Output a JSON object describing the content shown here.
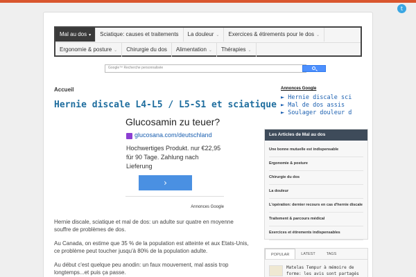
{
  "colors": {
    "accent": "#d9562e",
    "nav_active": "#3a3a3a",
    "link": "#1e6d9e",
    "twitter": "#3aa7e3"
  },
  "header": {
    "twitter_icon": "twitter-icon"
  },
  "nav": {
    "row1": [
      {
        "label": "Mal au dos",
        "active": true,
        "caret": "▾"
      },
      {
        "label": "Sciatique: causes et traitements"
      },
      {
        "label": "La douleur",
        "caret": "⌄"
      },
      {
        "label": "Exercices & étirements pour le dos",
        "caret": "⌄"
      }
    ],
    "row2": [
      {
        "label": "Ergonomie & posture",
        "caret": "⌄"
      },
      {
        "label": "Chirurgie du dos"
      },
      {
        "label": "Alimentation",
        "caret": "⌄"
      },
      {
        "label": "Thérapies",
        "caret": "⌄"
      }
    ]
  },
  "search": {
    "placeholder": "Google™ Recherche personnalisée"
  },
  "breadcrumb": "Accueil",
  "article": {
    "title": "Hernie discale L4-L5 / L5-S1 et sciatique",
    "paragraphs": [
      "Hernie discale, sciatique et mal de dos: un adulte sur quatre en moyenne souffre de problèmes de dos.",
      "Au Canada, on estime que 35 % de la population est atteinte et aux Etats-Unis, ce problème peut toucher jusqu'à 80% de la population adulte.",
      "Au début c'est quelque peu anodin: un faux mouvement, mal assis trop longtemps...et puis ça passe."
    ]
  },
  "ad": {
    "title": "Glucosamin zu teuer?",
    "url": "glucosana.com/deutschland",
    "text": "Hochwertiges Produkt. nur €22,95 für 90 Tage. Zahlung nach Lieferung",
    "button": "›",
    "label": "Annonces Google"
  },
  "sidebar": {
    "adsense_heading": "Annonces Google",
    "adsense_links": [
      "Hernie discale sci",
      "Mal de dos assis",
      "Soulager douleur d"
    ],
    "widget_title": "Les Articles de Mal au dos",
    "widget_items": [
      "Une bonne mutuelle est indispensable",
      "Ergonomie & posture",
      "Chirurgie du dos",
      "La douleur",
      "L'opération: dernier recours en cas d'hernie discale",
      "Traitement & parcours médical",
      "Exercices et étirements indispensables"
    ],
    "tabs": [
      "POPULAR",
      "LATEST",
      "TAGS"
    ],
    "popular_item": "Matelas Tempur à mémoire de forme: les avis sont partagés"
  }
}
